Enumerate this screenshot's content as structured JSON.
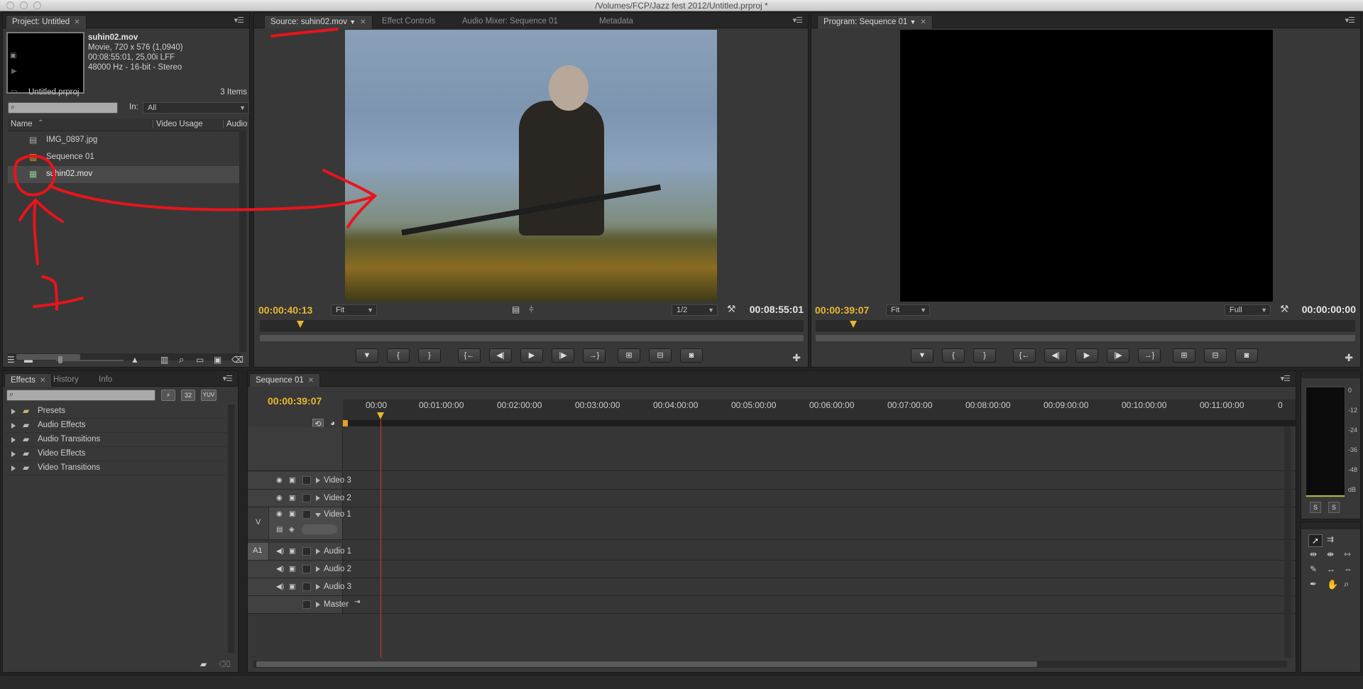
{
  "window": {
    "title": "/Volumes/FCP/Jazz fest 2012/Untitled.prproj *"
  },
  "project": {
    "tab": "Project: Untitled",
    "preview": {
      "name": "suhin02.mov",
      "line1": "Movie, 720 x 576 (1,0940)",
      "line2": "00:08:55:01, 25,00i LFF",
      "line3": "48000 Hz - 16-bit - Stereo"
    },
    "file": "Untitled.prproj",
    "count": "3 Items",
    "in_label": "In:",
    "in_value": "All",
    "columns": [
      "Name",
      "Video Usage",
      "Audio U"
    ],
    "items": [
      {
        "name": "IMG_0897.jpg",
        "icon": "image-file-icon"
      },
      {
        "name": "Sequence 01",
        "icon": "sequence-icon"
      },
      {
        "name": "suhin02.mov",
        "icon": "movie-file-icon"
      }
    ]
  },
  "source": {
    "tabs": [
      "Source: suhin02.mov",
      "Effect Controls",
      "Audio Mixer: Sequence 01",
      "Metadata"
    ],
    "timecode": "00:00:40:13",
    "duration": "00:08:55:01",
    "zoom": "Fit",
    "resolution": "1/2",
    "playhead_fraction": 0.075
  },
  "program": {
    "tab": "Program: Sequence 01",
    "timecode": "00:00:39:07",
    "duration": "00:00:00:00",
    "zoom": "Fit",
    "resolution": "Full",
    "playhead_fraction": 0.07
  },
  "effects": {
    "tabs": [
      "Effects",
      "History",
      "Info"
    ],
    "badges": [
      "32",
      "YUV"
    ],
    "folders": [
      "Presets",
      "Audio Effects",
      "Audio Transitions",
      "Video Effects",
      "Video Transitions"
    ]
  },
  "sequence": {
    "tab": "Sequence 01",
    "timecode": "00:00:39:07",
    "ruler": [
      "00:00",
      "00:01:00:00",
      "00:02:00:00",
      "00:03:00:00",
      "00:04:00:00",
      "00:05:00:00",
      "00:06:00:00",
      "00:07:00:00",
      "00:08:00:00",
      "00:09:00:00",
      "00:10:00:00",
      "00:11:00:00",
      "0"
    ],
    "video_tracks": [
      "Video 3",
      "Video 2",
      "Video 1"
    ],
    "audio_tracks": [
      "Audio 1",
      "Audio 2",
      "Audio 3"
    ],
    "master": "Master",
    "v_target": "V",
    "a_target": "A1"
  },
  "meter": {
    "scale": [
      "0",
      "-12",
      "-24",
      "-36",
      "-48",
      "dB"
    ],
    "solo": [
      "S",
      "S"
    ]
  },
  "colors": {
    "timecode": "#e8b730",
    "annotation": "#e8141c",
    "playhead": "#d83a2c",
    "panel": "#383838"
  }
}
